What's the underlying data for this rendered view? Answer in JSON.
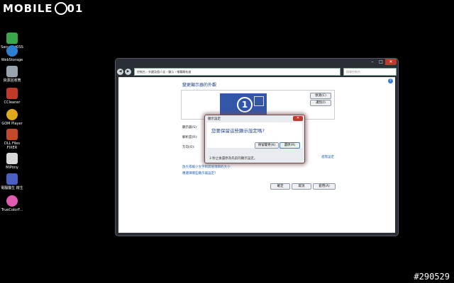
{
  "brand": {
    "logo_text": "MOBILE",
    "logo_suffix": "01"
  },
  "watermark": "#290529",
  "desktop_icons": [
    {
      "label": "SecurityKISS Tunnel",
      "color": "#3aa84a"
    },
    {
      "label": "WebStorage",
      "color": "#2c7fd1"
    },
    {
      "label": "資源回收筒",
      "color": "#9aa4ae"
    },
    {
      "label": "CCleaner",
      "color": "#c0392b"
    },
    {
      "label": "GOM Player",
      "color": "#e0a81e"
    },
    {
      "label": "DLL Files FIXER",
      "color": "#c24a2a"
    },
    {
      "label": "MiPony",
      "color": "#d8d8d8"
    },
    {
      "label": "電腦醫生 啟生",
      "color": "#4a5fc1"
    },
    {
      "label": "TrueColorF...",
      "color": "#e05cb0"
    }
  ],
  "window": {
    "breadcrumb": "控制台 › 外觀及個人化 › 顯示 › 螢幕解析度",
    "search_placeholder": "搜尋控制台",
    "heading": "變更顯示器的外觀",
    "monitor_number": "1",
    "detect_button": "偵測(C)",
    "identify_button": "識別(I)",
    "display_label": "顯示器(S):",
    "resolution_label": "解析度(R):",
    "orientation_label": "方向(O):",
    "advanced_link": "進階設定",
    "link_text_size": "放大或縮小文字和其他項目的大小",
    "link_which_settings": "應選擇哪些顯示器設定?",
    "ok_button": "確定",
    "cancel_button": "取消",
    "apply_button": "套用(A)"
  },
  "dialog": {
    "title": "顯示設定",
    "question": "您要保留這些顯示設定嗎?",
    "keep_button": "保留變更(K)",
    "revert_button": "還原(R)",
    "countdown": "3 秒之後還原為先前的顯示設定。"
  }
}
